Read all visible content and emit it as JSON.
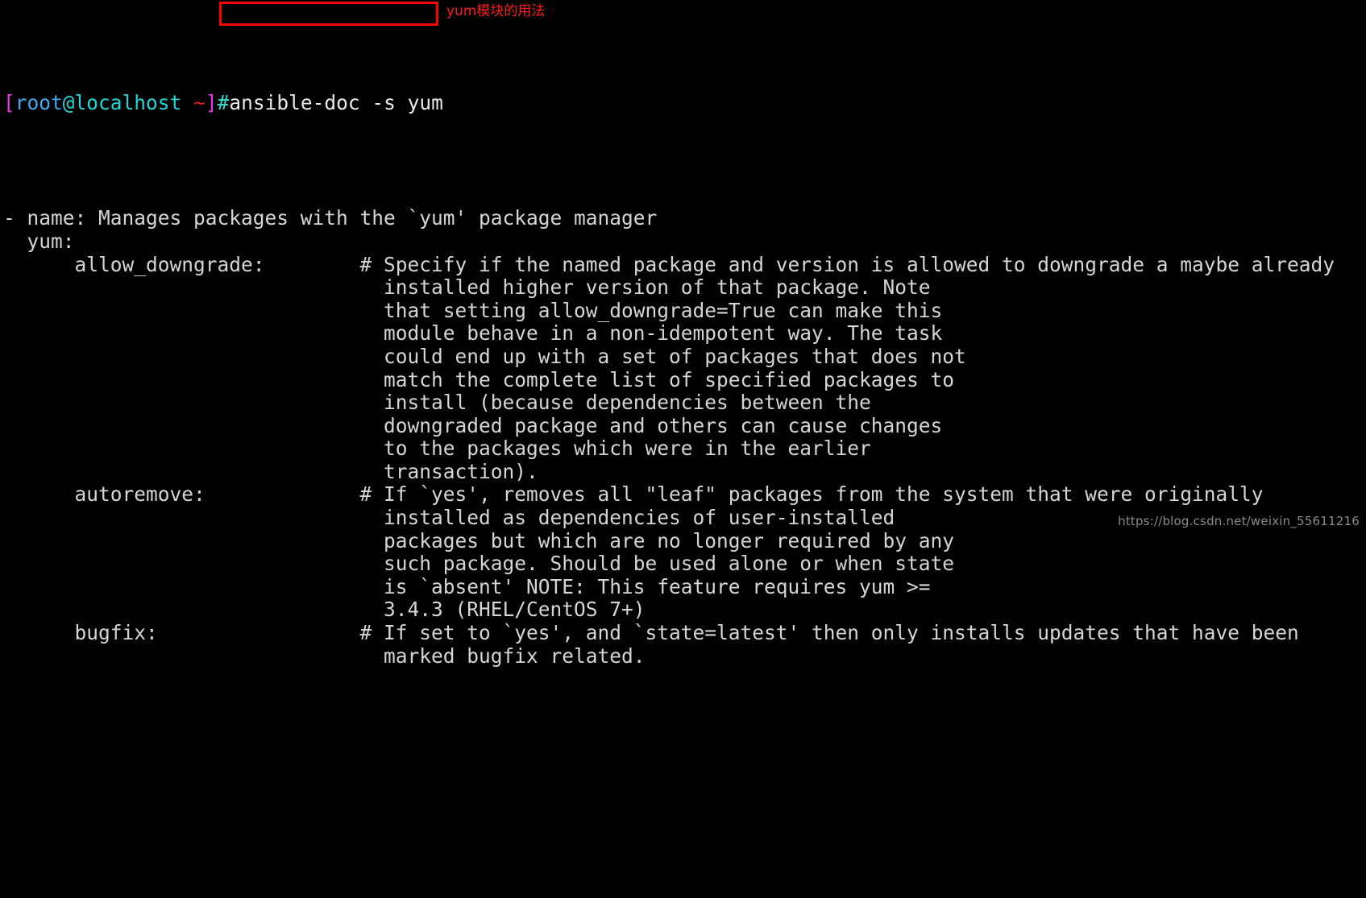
{
  "terminal": {
    "background_color": "#000000",
    "foreground_color": "#d5d5d5",
    "prompt": {
      "open_bracket": "[",
      "user": "root",
      "at": "@",
      "host": "localhost",
      "space_tilde": " ~",
      "close_bracket": "]",
      "hash": "#",
      "colors": {
        "bracket": "#e838e8",
        "user": "#3ea8f0",
        "at": "#1fd6d6",
        "host": "#1fd6d6",
        "tilde": "#e02020",
        "hash": "#2fe0d0"
      }
    },
    "command": "ansible-doc -s yum",
    "output_lines": [
      "- name: Manages packages with the `yum' package manager",
      "  yum:",
      "      allow_downgrade:        # Specify if the named package and version is allowed to downgrade a maybe already",
      "                                installed higher version of that package. Note",
      "                                that setting allow_downgrade=True can make this",
      "                                module behave in a non-idempotent way. The task",
      "                                could end up with a set of packages that does not",
      "                                match the complete list of specified packages to",
      "                                install (because dependencies between the",
      "                                downgraded package and others can cause changes",
      "                                to the packages which were in the earlier",
      "                                transaction).",
      "      autoremove:             # If `yes', removes all \"leaf\" packages from the system that were originally",
      "                                installed as dependencies of user-installed",
      "                                packages but which are no longer required by any",
      "                                such package. Should be used alone or when state",
      "                                is `absent' NOTE: This feature requires yum >=",
      "                                3.4.3 (RHEL/CentOS 7+)",
      "      bugfix:                 # If set to `yes', and `state=latest' then only installs updates that have been",
      "                                marked bugfix related."
    ]
  },
  "annotations": {
    "command_note": "yum模块的用法",
    "command_note_color": "#ff1a1a",
    "highlight_box_color": "#ff0000"
  },
  "watermark": {
    "text": "https://blog.csdn.net/weixin_55611216",
    "color": "#8a8a8a"
  }
}
